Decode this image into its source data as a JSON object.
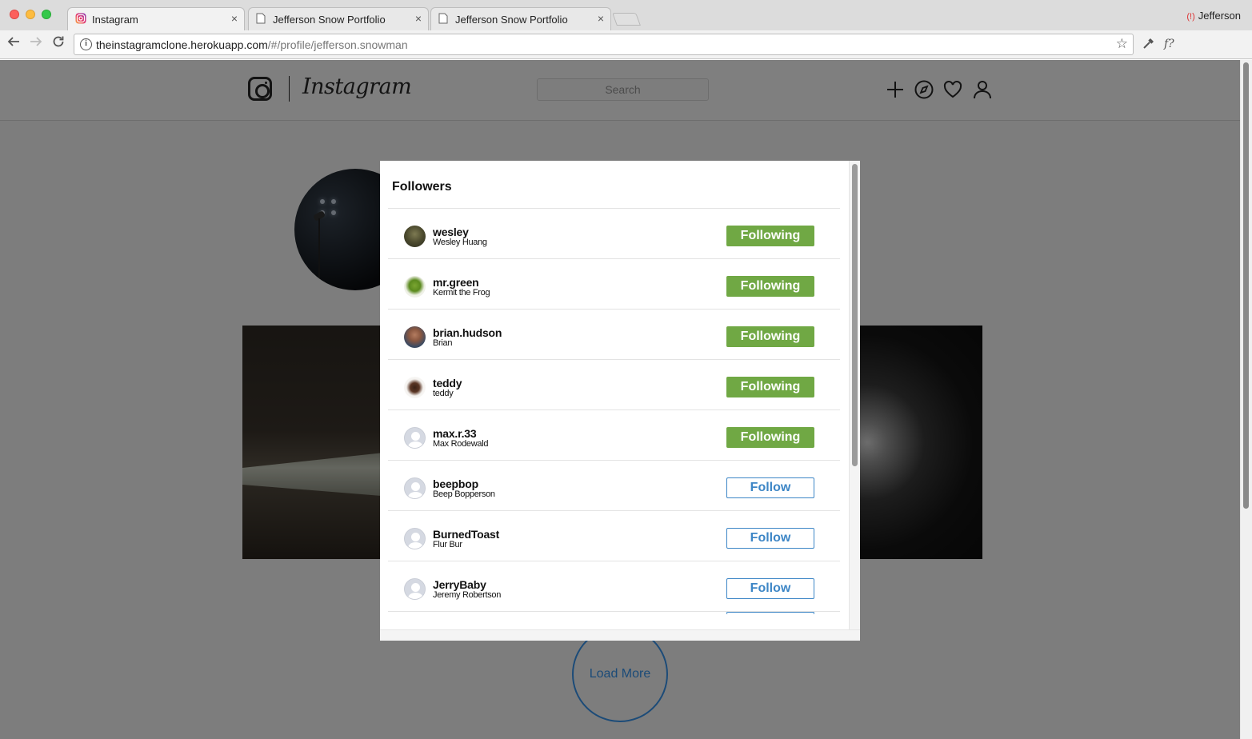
{
  "browser": {
    "tabs": [
      {
        "title": "Instagram",
        "close": "×"
      },
      {
        "title": "Jefferson Snow Portfolio",
        "close": "×"
      },
      {
        "title": "Jefferson Snow Portfolio",
        "close": "×"
      }
    ],
    "profile_name": "Jefferson",
    "url_host": "theinstagramclone.herokuapp.com",
    "url_path": "/#/profile/jefferson.snowman",
    "ext_m": "m",
    "ext_f": "f?"
  },
  "header": {
    "wordmark": "Instagram",
    "search_placeholder": "Search"
  },
  "load_more": "Load More",
  "modal": {
    "title": "Followers",
    "followers": [
      {
        "username": "wesley",
        "fullname": "Wesley Huang",
        "button": "Following"
      },
      {
        "username": "mr.green",
        "fullname": "Kermit the Frog",
        "button": "Following"
      },
      {
        "username": "brian.hudson",
        "fullname": "Brian",
        "button": "Following"
      },
      {
        "username": "teddy",
        "fullname": "teddy",
        "button": "Following"
      },
      {
        "username": "max.r.33",
        "fullname": "Max Rodewald",
        "button": "Following"
      },
      {
        "username": "beepbop",
        "fullname": "Beep Bopperson",
        "button": "Follow"
      },
      {
        "username": "BurnedToast",
        "fullname": "Flur Bur",
        "button": "Follow"
      },
      {
        "username": "JerryBaby",
        "fullname": "Jeremy Robertson",
        "button": "Follow"
      }
    ]
  }
}
